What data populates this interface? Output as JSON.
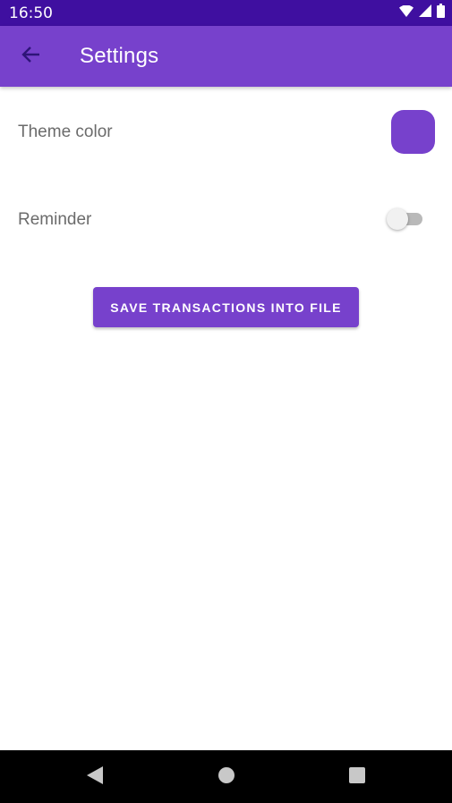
{
  "status_bar": {
    "time": "16:50",
    "icons": [
      "wifi-icon",
      "cellular-signal-icon",
      "battery-icon"
    ]
  },
  "app_bar": {
    "title": "Settings",
    "back_icon": "arrow-back-icon"
  },
  "settings": {
    "theme_color_label": "Theme color",
    "theme_color_value": "#7741cc",
    "reminder_label": "Reminder",
    "reminder_enabled": false
  },
  "actions": {
    "save_label": "SAVE TRANSACTIONS INTO FILE"
  },
  "nav_bar": {
    "buttons": [
      "back-triangle-icon",
      "home-circle-icon",
      "recents-square-icon"
    ]
  },
  "colors": {
    "status_bar": "#3f0fa0",
    "primary": "#7741cc",
    "text_secondary": "#6b6b6b"
  }
}
